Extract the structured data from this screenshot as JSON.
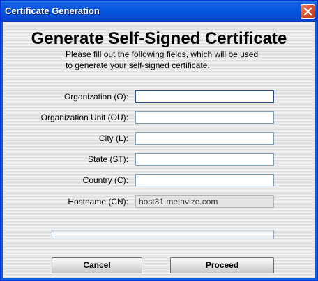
{
  "window": {
    "title": "Certificate Generation",
    "close_icon": "close-icon"
  },
  "heading": "Generate Self-Signed Certificate",
  "description": [
    "Please fill out the following fields, which will be used",
    "to generate your self-signed certificate."
  ],
  "fields": [
    {
      "label": "Organization (O):",
      "value": "",
      "editable": true
    },
    {
      "label": "Organization Unit (OU):",
      "value": "",
      "editable": true
    },
    {
      "label": "City (L):",
      "value": "",
      "editable": true
    },
    {
      "label": "State (ST):",
      "value": "",
      "editable": true
    },
    {
      "label": "Country (C):",
      "value": "",
      "editable": true
    },
    {
      "label": "Hostname (CN):",
      "value": "host31.metavize.com",
      "editable": false
    }
  ],
  "progress": 0,
  "buttons": {
    "cancel": "Cancel",
    "proceed": "Proceed"
  },
  "colors": {
    "titlebar": "#0656e0",
    "close": "#d64f2a"
  }
}
